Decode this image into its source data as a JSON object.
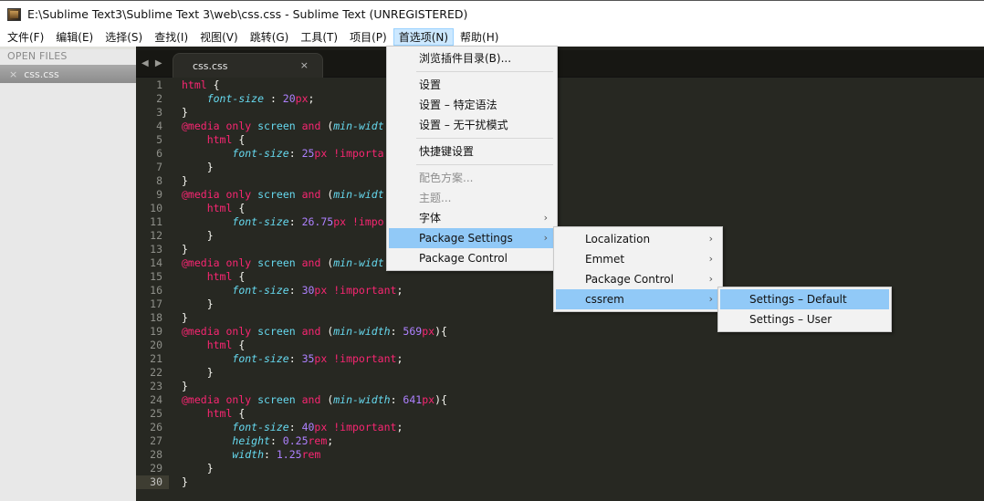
{
  "window": {
    "title": "E:\\Sublime Text3\\Sublime Text 3\\web\\css.css - Sublime Text (UNREGISTERED)",
    "icon": "sublime-text-app-icon"
  },
  "menubar": {
    "items": [
      {
        "label": "文件(F)"
      },
      {
        "label": "编辑(E)"
      },
      {
        "label": "选择(S)"
      },
      {
        "label": "查找(I)"
      },
      {
        "label": "视图(V)"
      },
      {
        "label": "跳转(G)"
      },
      {
        "label": "工具(T)"
      },
      {
        "label": "项目(P)"
      },
      {
        "label": "首选项(N)",
        "active": true
      },
      {
        "label": "帮助(H)"
      }
    ]
  },
  "sidebar": {
    "header": "OPEN FILES",
    "files": [
      {
        "name": "css.css",
        "close_icon": "×"
      }
    ]
  },
  "tabs": {
    "nav_icon": "◀ ▶",
    "items": [
      {
        "label": "css.css",
        "close_icon": "×"
      }
    ]
  },
  "editor": {
    "current_line": 30,
    "lines": [
      "1",
      "2",
      "3",
      "4",
      "5",
      "6",
      "7",
      "8",
      "9",
      "10",
      "11",
      "12",
      "13",
      "14",
      "15",
      "16",
      "17",
      "18",
      "19",
      "20",
      "21",
      "22",
      "23",
      "24",
      "25",
      "26",
      "27",
      "28",
      "29",
      "30"
    ],
    "code": {
      "html": "html",
      "brace_open": " {",
      "brace_close": "}",
      "font_size": "font-size",
      "sep1": " : ",
      "sep2": ": ",
      "semi": ";",
      "media": "@media",
      "only": "only",
      "screen": "screen",
      "and": "and",
      "min_width": "min-width",
      "min_widt": "min-widt",
      "v20": "20",
      "v25": "25",
      "v26_75": "26.75",
      "v30": "30",
      "v35": "35",
      "v40": "40",
      "v569": "569",
      "v641": "641",
      "v0_25": "0.25",
      "v1_25": "1.25",
      "px": "px",
      "rem": "rem",
      "important": "!important",
      "importa": "!importa",
      "impo": "!impo",
      "height": "height",
      "width": "width",
      "paren_close": "){"
    }
  },
  "menus": {
    "preferences": {
      "items": [
        {
          "label": "浏览插件目录(B)..."
        },
        {
          "separator": true
        },
        {
          "label": "设置"
        },
        {
          "label": "设置 – 特定语法"
        },
        {
          "label": "设置 – 无干扰模式"
        },
        {
          "separator": true
        },
        {
          "label": "快捷键设置"
        },
        {
          "separator": true
        },
        {
          "label": "配色方案...",
          "disabled": true
        },
        {
          "label": "主题...",
          "disabled": true
        },
        {
          "label": "字体",
          "submenu": true
        },
        {
          "label": "Package Settings",
          "submenu": true,
          "highlighted": true
        },
        {
          "label": "Package Control"
        }
      ]
    },
    "package_settings": {
      "items": [
        {
          "label": "Localization",
          "submenu": true
        },
        {
          "label": "Emmet",
          "submenu": true
        },
        {
          "label": "Package Control",
          "submenu": true
        },
        {
          "label": "cssrem",
          "submenu": true,
          "highlighted": true
        }
      ]
    },
    "cssrem": {
      "items": [
        {
          "label": "Settings – Default",
          "highlighted": true
        },
        {
          "label": "Settings – User"
        }
      ]
    },
    "submenu_arrow": "›"
  },
  "colors": {
    "editor_bg": "#272822",
    "menu_highlight": "#91c9f7",
    "menubar_active": "#cce8ff",
    "keyword": "#f92672",
    "property": "#66d9ef",
    "number": "#ae81ff"
  }
}
